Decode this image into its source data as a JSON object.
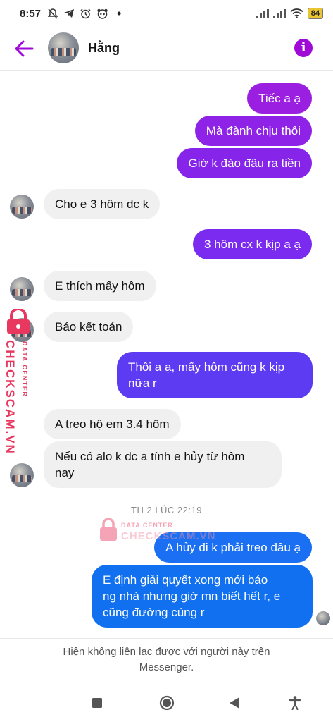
{
  "status_bar": {
    "time": "8:57",
    "battery": "84",
    "left_icons": [
      "bell-off-icon",
      "telegram-icon",
      "alarm-icon",
      "panda-icon",
      "dot-icon"
    ],
    "right_icons": [
      "signal-icon",
      "signal-icon",
      "wifi-icon",
      "battery-icon"
    ]
  },
  "header": {
    "contact_name": "Hằng",
    "accent_color": "#a00ad6"
  },
  "messages": [
    {
      "side": "out",
      "text": "Tiếc a ạ",
      "color": "#9b1fe0"
    },
    {
      "side": "out",
      "text": "Mà đành chịu thôi",
      "color": "#8e22e6"
    },
    {
      "side": "out",
      "text": "Giờ k đào đâu ra tiền",
      "color": "#8624ea"
    },
    {
      "side": "in",
      "text": "Cho e 3 hôm dc k"
    },
    {
      "side": "out",
      "text": "3 hôm cx k kịp a ạ",
      "color": "#7b2bf0"
    },
    {
      "side": "in",
      "text": "E thích mấy hôm"
    },
    {
      "side": "in",
      "text": "Báo kết toán"
    },
    {
      "side": "out",
      "lines": [
        "Thôi a ạ, mấy hôm cũng k kịp",
        "nữa r"
      ],
      "color": "#5d3bf2"
    },
    {
      "side": "in",
      "text": "A treo hộ em 3.4 hôm"
    },
    {
      "side": "in",
      "lines": [
        "Nếu có alo k dc a tính e hủy từ hôm",
        "nay"
      ]
    },
    {
      "side": "out",
      "text": "A hủy đi k phải treo đâu ạ",
      "color": "#1b6ff2"
    },
    {
      "side": "out",
      "lines": [
        "E định giải quyết xong mới báo",
        "ng nhà nhưng giờ mn biết hết r, e",
        "cũng đường cùng r"
      ],
      "color": "#1170f0"
    }
  ],
  "timestamp": "TH 2 LÚC 22:19",
  "watermark": {
    "brand": "CHECKSCAM.VN",
    "sub": "DATA CENTER",
    "color": "#e8385f"
  },
  "footer_notice": {
    "line1": "Hiện không liên lạc được với người này trên",
    "line2": "Messenger."
  },
  "nav_bar": {
    "buttons": [
      "recent-apps-icon",
      "home-icon",
      "back-icon",
      "accessibility-icon"
    ]
  }
}
